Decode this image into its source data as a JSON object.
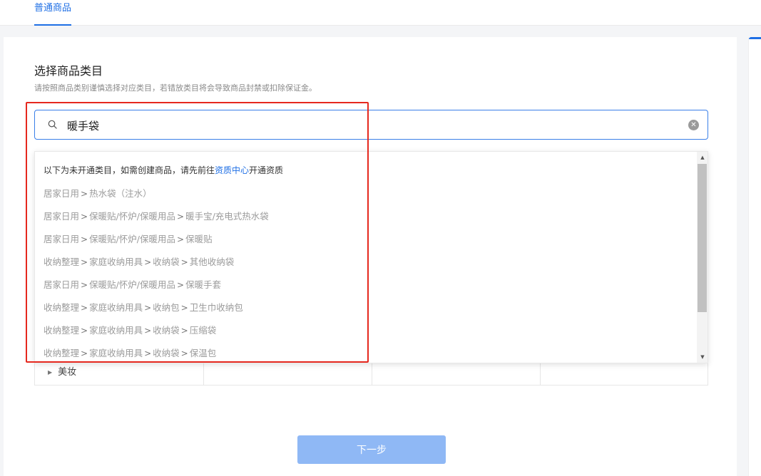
{
  "tabs": [
    {
      "label": "普通商品",
      "active": true
    }
  ],
  "section": {
    "title": "选择商品类目",
    "subtitle": "请按照商品类别谨慎选择对应类目，若错放类目将会导致商品封禁或扣除保证金。"
  },
  "search": {
    "value": "暖手袋",
    "icon": "search-icon",
    "clear_icon": "close-circle-icon"
  },
  "dropdown": {
    "notice_prefix": "以下为未开通类目，如需创建商品，请先前往",
    "notice_link": "资质中心",
    "notice_suffix": "开通资质",
    "items": [
      [
        "居家日用",
        "热水袋（注水）"
      ],
      [
        "居家日用",
        "保暖贴/怀炉/保暖用品",
        "暖手宝/充电式热水袋"
      ],
      [
        "居家日用",
        "保暖贴/怀炉/保暖用品",
        "保暖贴"
      ],
      [
        "收纳整理",
        "家庭收纳用具",
        "收纳袋",
        "其他收纳袋"
      ],
      [
        "居家日用",
        "保暖贴/怀炉/保暖用品",
        "保暖手套"
      ],
      [
        "收纳整理",
        "家庭收纳用具",
        "收纳包",
        "卫生巾收纳包"
      ],
      [
        "收纳整理",
        "家庭收纳用具",
        "收纳袋",
        "压缩袋"
      ],
      [
        "收纳整理",
        "家庭收纳用具",
        "收纳袋",
        "保温包"
      ]
    ]
  },
  "category_table": {
    "visible_row": "美妆"
  },
  "next_button": {
    "label": "下一步",
    "disabled": true
  },
  "colors": {
    "accent": "#1f6fe5",
    "highlight": "#e5281e",
    "button_disabled": "#8fb8f5"
  }
}
